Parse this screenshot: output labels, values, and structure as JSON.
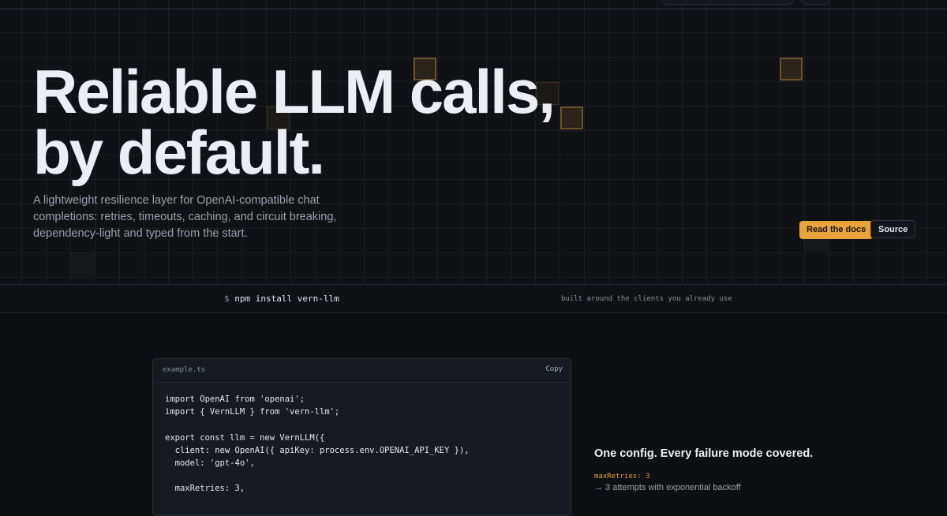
{
  "hero": {
    "headline_line1": "Reliable LLM calls,",
    "headline_line2": "by default.",
    "subtitle": "A lightweight resilience layer for OpenAI-compatible chat completions: retries, timeouts, caching, and circuit breaking, dependency-light and typed from the start.",
    "read_docs_label": "Read the docs",
    "source_label": "Source"
  },
  "install_band": {
    "prompt": "$",
    "command": "npm install vern-llm",
    "clients_text": "built around the clients you already use"
  },
  "code_example": {
    "filename": "example.ts",
    "copy_label": "Copy",
    "code": "import OpenAI from 'openai';\nimport { VernLLM } from 'vern-llm';\n\nexport const llm = new VernLLM({\n  client: new OpenAI({ apiKey: process.env.OPENAI_API_KEY }),\n  model: 'gpt-4o',\n\n  maxRetries: 3,"
  },
  "features": {
    "title": "One config. Every failure mode covered.",
    "items": [
      {
        "key": "maxRetries: 3",
        "desc": "→ 3 attempts with exponential backoff"
      }
    ]
  },
  "colors": {
    "background": "#0d0f13",
    "accent": "#e8a33d",
    "text": "#eceef3",
    "muted": "#9aa0ac"
  }
}
